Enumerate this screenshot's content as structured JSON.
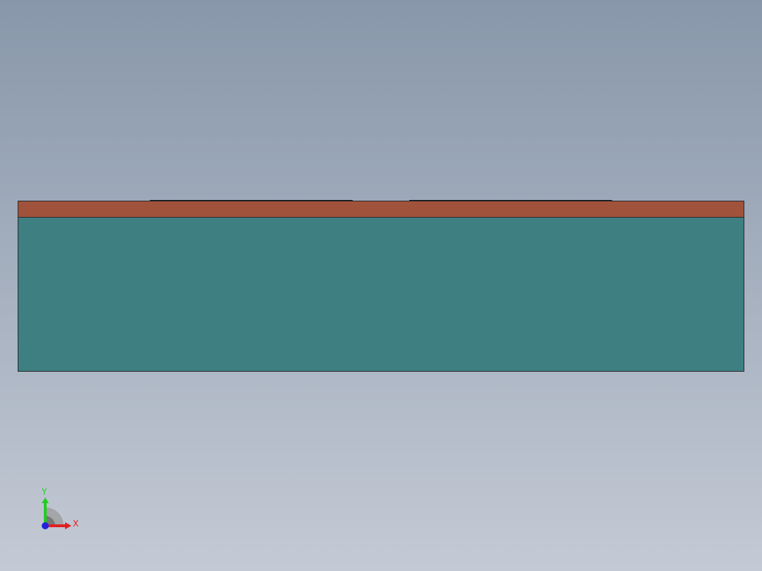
{
  "viewport": {
    "background_top": "#8897aa",
    "background_bottom": "#c4cad5"
  },
  "model": {
    "copper_color": "#a0523a",
    "substrate_color": "#3e7f82",
    "edge_color": "#111111"
  },
  "triad": {
    "x_label": "X",
    "y_label": "Y",
    "x_color": "#e02020",
    "y_color": "#22cc22",
    "z_color": "#2222dd"
  }
}
